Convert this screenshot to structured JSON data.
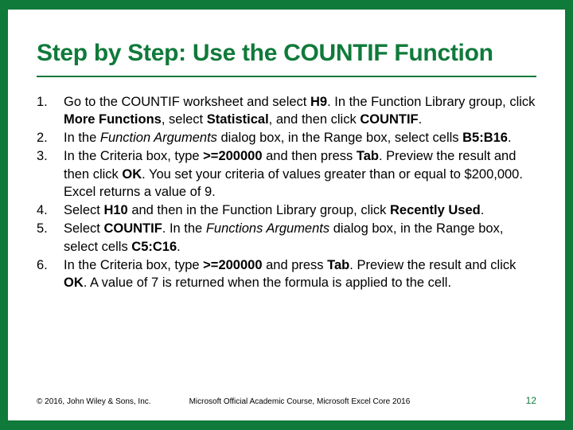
{
  "title": "Step by Step: Use the COUNTIF Function",
  "steps": [
    {
      "n": "1.",
      "html": "Go to the COUNTIF worksheet and select <b>H9</b>. In the Function Library group, click <b>More Functions</b>, select <b>Statistical</b>, and then click <b>COUNTIF</b>."
    },
    {
      "n": "2.",
      "html": "In the <i>Function Arguments</i> dialog box, in the Range box, select cells <b>B5:B16</b>."
    },
    {
      "n": "3.",
      "html": "In the Criteria box, type <b>&gt;=200000</b> and then press <b>Tab</b>. Preview the result and then click <b>OK</b>. You set your criteria of values greater than or equal to $200,000. Excel returns a value of 9."
    },
    {
      "n": "4.",
      "html": "Select <b>H10</b> and then in the Function Library group, click <b>Recently Used</b>."
    },
    {
      "n": "5.",
      "html": "Select <b>COUNTIF</b>. In the <i>Functions Arguments</i> dialog box, in the Range box, select cells <b>C5:C16</b>."
    },
    {
      "n": "6.",
      "html": "In the Criteria box, type <b>&gt;=200000</b> and press <b>Tab</b>. Preview the result and click <b>OK</b>. A value of 7 is returned when the formula is applied to the cell."
    }
  ],
  "footer": {
    "copyright": "© 2016, John Wiley & Sons, Inc.",
    "course": "Microsoft Official Academic Course, Microsoft Excel Core 2016",
    "page": "12"
  }
}
